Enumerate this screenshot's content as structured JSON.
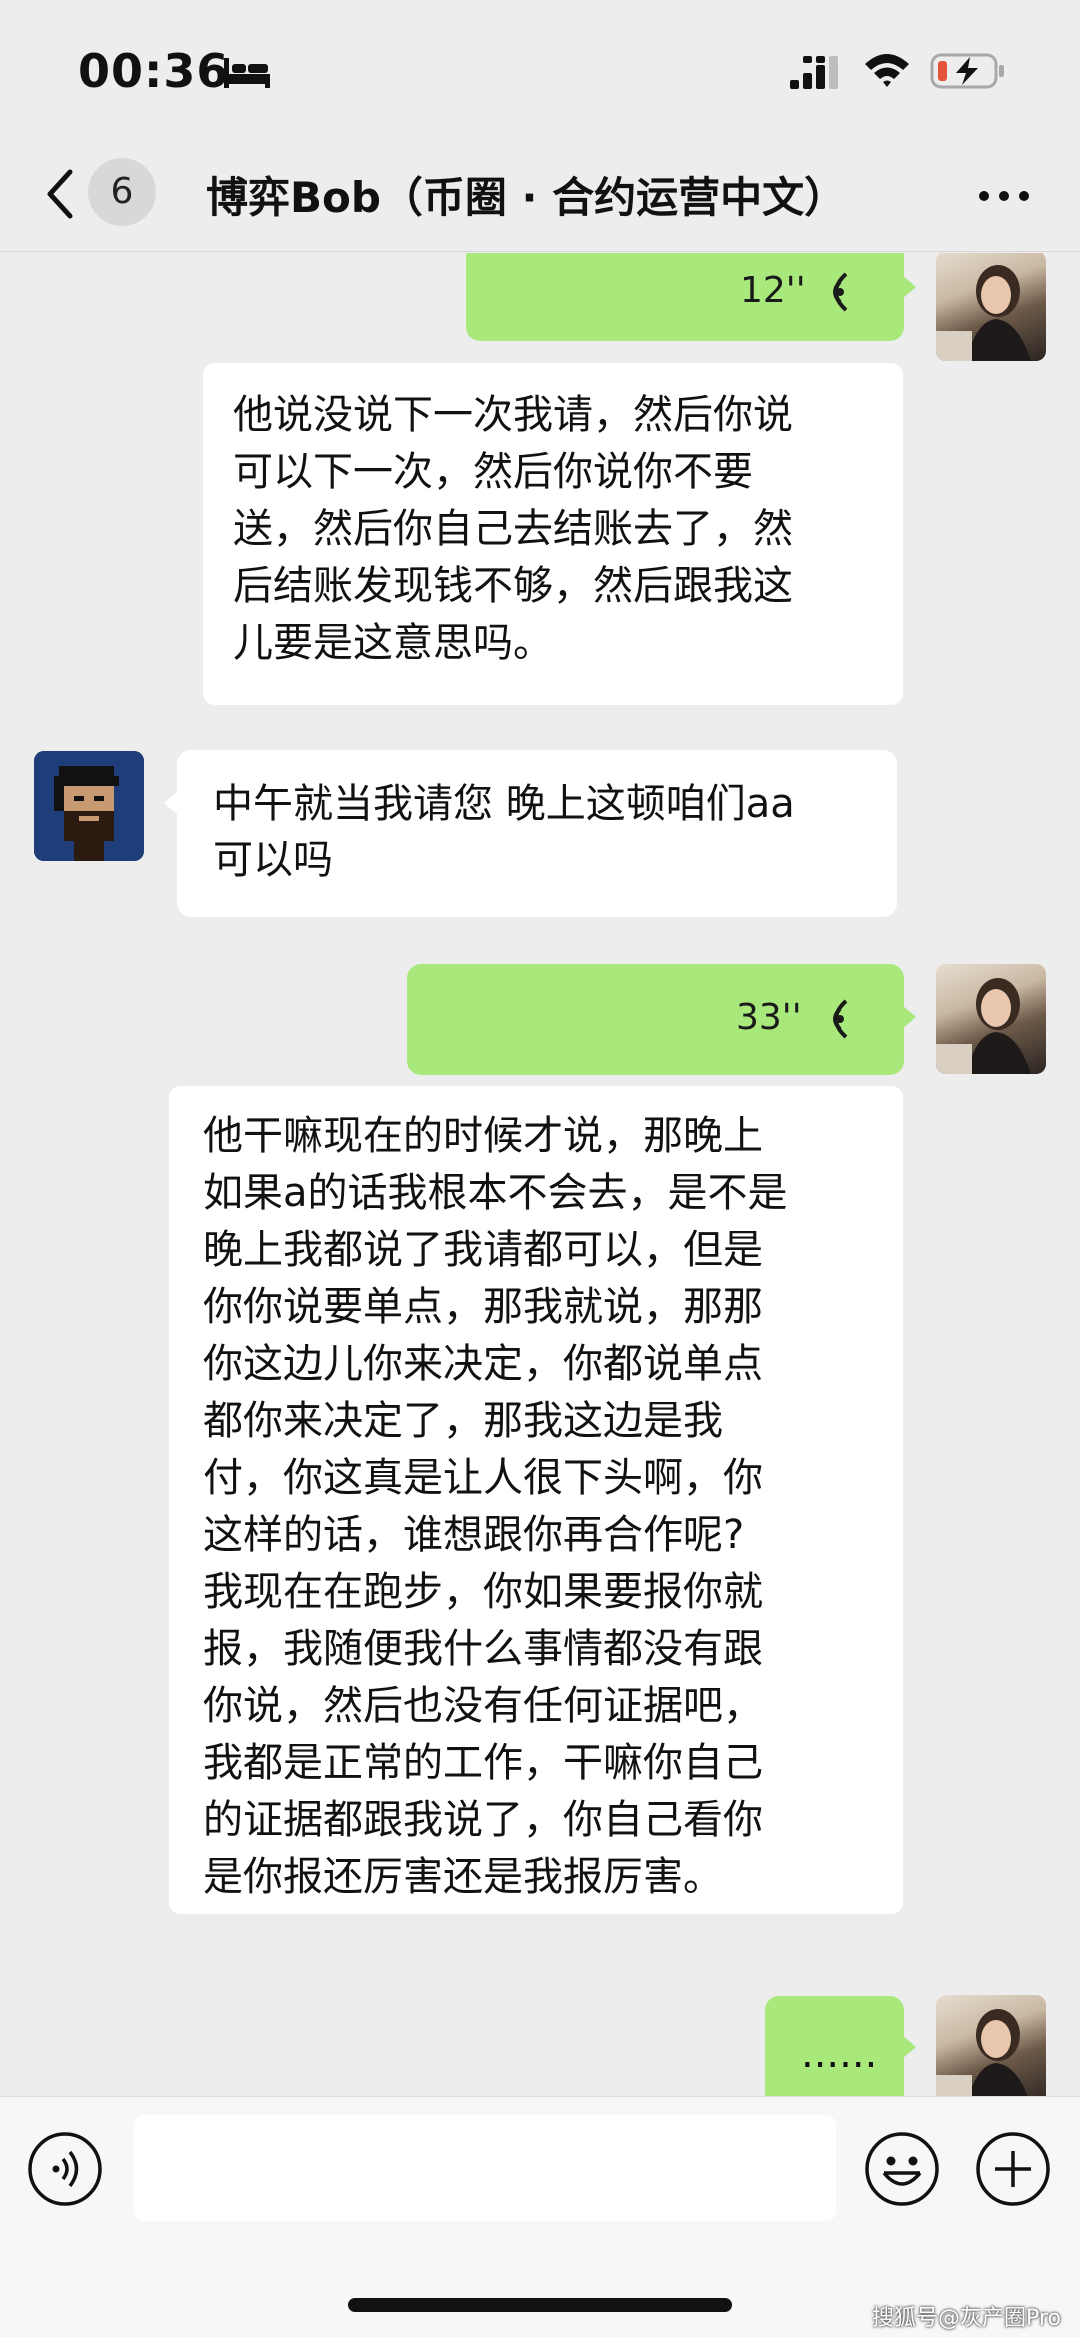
{
  "status_bar": {
    "time": "00:36",
    "icons": [
      "sleep-bed-icon",
      "cellular-signal-icon",
      "wifi-icon",
      "battery-charging-icon"
    ]
  },
  "nav": {
    "unread_count": "6",
    "title": "博弈Bob（币圈 · 合约运营中文）",
    "icons": [
      "back-chevron-icon",
      "more-dots-icon"
    ]
  },
  "messages": [
    {
      "sender": "me",
      "type": "voice",
      "duration": "12''",
      "transcript": [
        "他说没说下一次我请，然后你说",
        "可以下一次，然后你说你不要",
        "送，然后你自己去结账去了，然",
        "后结账发现钱不够，然后跟我这",
        "儿要是这意思吗。"
      ]
    },
    {
      "sender": "bob",
      "type": "text",
      "lines": [
        "中午就当我请您 晚上这顿咱们aa",
        "可以吗"
      ]
    },
    {
      "sender": "me",
      "type": "voice",
      "duration": "33''",
      "transcript": [
        "他干嘛现在的时候才说，那晚上",
        "如果a的话我根本不会去，是不是",
        "晚上我都说了我请都可以，但是",
        "你你说要单点，那我就说，那那",
        "你这边儿你来决定，你都说单点",
        "都你来决定了，那我这边是我",
        "付，你这真是让人很下头啊，你",
        "这样的话，谁想跟你再合作呢?",
        "我现在在跑步，你如果要报你就",
        "报，我随便我什么事情都没有跟",
        "你说，然后也没有任何证据吧，",
        "我都是正常的工作，干嘛你自己",
        "的证据都跟我说了，你自己看你",
        "是你报还厉害还是我报厉害。"
      ]
    },
    {
      "sender": "me",
      "type": "text",
      "lines": [
        "......"
      ]
    }
  ],
  "input_bar": {
    "placeholder": "",
    "icons": [
      "voice-input-icon",
      "emoji-icon",
      "plus-icon"
    ]
  },
  "watermark": "搜狐号@灰产圈Pro",
  "colors": {
    "background": "#ededed",
    "outgoing_bubble": "#a9e97c",
    "incoming_bubble": "#ffffff",
    "battery_low": "#e5533a"
  }
}
